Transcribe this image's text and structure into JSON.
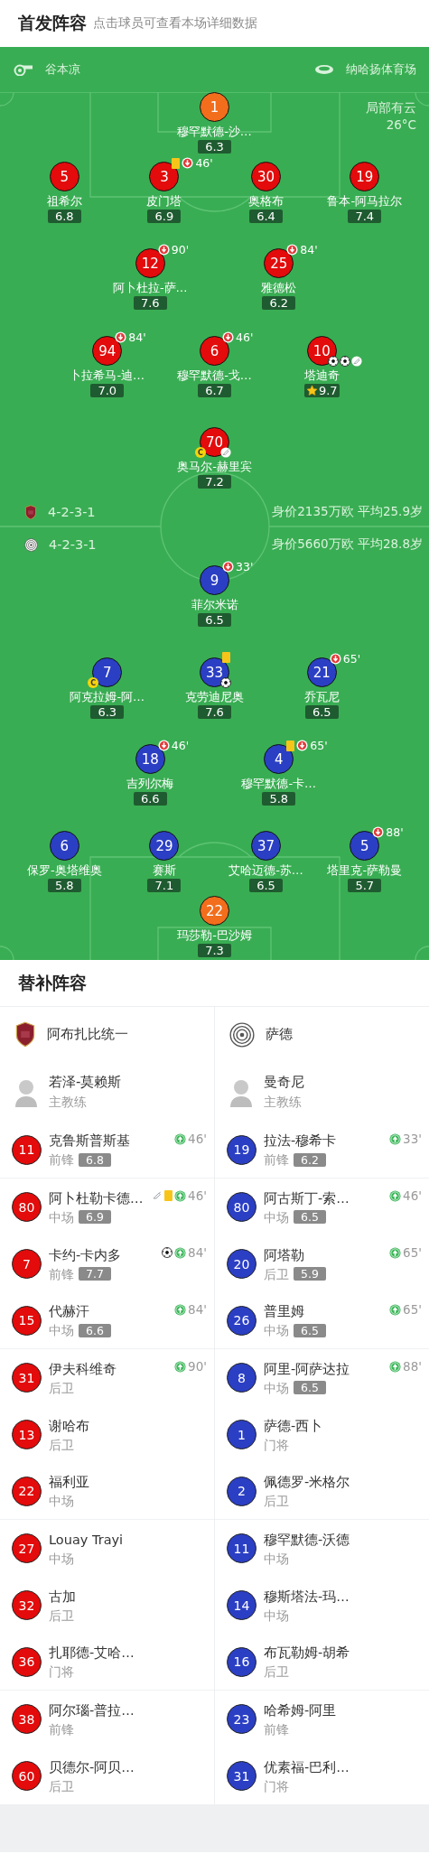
{
  "header": {
    "title": "首发阵容",
    "subtitle": "点击球员可查看本场详细数据"
  },
  "pitch": {
    "referee": "谷本凉",
    "stadium": "纳哈扬体育场",
    "weather": "局部有云",
    "temperature": "26°C",
    "home": {
      "formation": "4-2-3-1",
      "summary": "身价2135万欧 平均25.9岁",
      "lines": [
        {
          "players": [
            {
              "number": "1",
              "name": "穆罕默德-沙…",
              "rating": "6.3",
              "color": "#f26d1c",
              "mvp": false
            }
          ]
        },
        {
          "players": [
            {
              "number": "5",
              "name": "祖希尔",
              "rating": "6.8",
              "color": "#e30b0b",
              "mvp": false
            },
            {
              "number": "3",
              "name": "皮门塔",
              "rating": "6.9",
              "color": "#e30b0b",
              "mvp": false,
              "events": [
                {
                  "kind": "yellow_card"
                },
                {
                  "kind": "sub_off",
                  "minute": "46'"
                }
              ]
            },
            {
              "number": "30",
              "name": "奥格布",
              "rating": "6.4",
              "color": "#e30b0b",
              "mvp": false
            },
            {
              "number": "19",
              "name": "鲁本-阿马拉尔",
              "rating": "7.4",
              "color": "#e30b0b",
              "mvp": false
            }
          ]
        },
        {
          "players": [
            {
              "number": "12",
              "name": "阿卜杜拉-萨…",
              "rating": "7.6",
              "color": "#e30b0b",
              "mvp": false,
              "events": [
                {
                  "kind": "sub_off",
                  "minute": "90'"
                }
              ]
            },
            {
              "number": "25",
              "name": "雅德松",
              "rating": "6.2",
              "color": "#e30b0b",
              "mvp": false,
              "events": [
                {
                  "kind": "sub_off",
                  "minute": "84'"
                }
              ]
            }
          ]
        },
        {
          "players": [
            {
              "number": "94",
              "name": "卜拉希马-迪…",
              "rating": "7.0",
              "color": "#e30b0b",
              "mvp": false,
              "events": [
                {
                  "kind": "sub_off",
                  "minute": "84'"
                }
              ]
            },
            {
              "number": "6",
              "name": "穆罕默德-戈…",
              "rating": "6.7",
              "color": "#e30b0b",
              "mvp": false,
              "events": [
                {
                  "kind": "sub_off",
                  "minute": "46'"
                }
              ]
            },
            {
              "number": "10",
              "name": "塔迪奇",
              "rating": "9.7",
              "color": "#e30b0b",
              "mvp": true,
              "events": [
                {
                  "kind": "goal"
                },
                {
                  "kind": "goal"
                },
                {
                  "kind": "assist"
                }
              ]
            }
          ]
        },
        {
          "players": [
            {
              "number": "70",
              "name": "奥马尔-赫里宾",
              "rating": "7.2",
              "color": "#e30b0b",
              "mvp": false,
              "captain_badge": "C",
              "events": [
                {
                  "kind": "assist"
                }
              ]
            }
          ]
        }
      ]
    },
    "away": {
      "formation": "4-2-3-1",
      "summary": "身价5660万欧 平均28.8岁",
      "lines": [
        {
          "players": [
            {
              "number": "9",
              "name": "菲尔米诺",
              "rating": "6.5",
              "color": "#2b3fc4",
              "mvp": false,
              "events": [
                {
                  "kind": "sub_off",
                  "minute": "33'"
                }
              ]
            }
          ]
        },
        {
          "players": [
            {
              "number": "7",
              "name": "阿克拉姆-阿…",
              "rating": "6.3",
              "color": "#2b3fc4",
              "mvp": false,
              "captain_badge": "C"
            },
            {
              "number": "33",
              "name": "克劳迪尼奥",
              "rating": "7.6",
              "color": "#2b3fc4",
              "mvp": false,
              "events": [
                {
                  "kind": "yellow_card"
                },
                {
                  "kind": "goal"
                }
              ]
            },
            {
              "number": "21",
              "name": "乔瓦尼",
              "rating": "6.5",
              "color": "#2b3fc4",
              "mvp": false,
              "events": [
                {
                  "kind": "sub_off",
                  "minute": "65'"
                }
              ]
            }
          ]
        },
        {
          "players": [
            {
              "number": "18",
              "name": "吉列尔梅",
              "rating": "6.6",
              "color": "#2b3fc4",
              "mvp": false,
              "events": [
                {
                  "kind": "sub_off",
                  "minute": "46'"
                }
              ]
            },
            {
              "number": "4",
              "name": "穆罕默德-卡…",
              "rating": "5.8",
              "color": "#2b3fc4",
              "mvp": false,
              "events": [
                {
                  "kind": "yellow_card"
                },
                {
                  "kind": "sub_off",
                  "minute": "65'"
                }
              ]
            }
          ]
        },
        {
          "players": [
            {
              "number": "6",
              "name": "保罗-奥塔维奥",
              "rating": "5.8",
              "color": "#2b3fc4",
              "mvp": false
            },
            {
              "number": "29",
              "name": "赛斯",
              "rating": "7.1",
              "color": "#2b3fc4",
              "mvp": false
            },
            {
              "number": "37",
              "name": "艾哈迈德-苏…",
              "rating": "6.5",
              "color": "#2b3fc4",
              "mvp": false
            },
            {
              "number": "5",
              "name": "塔里克-萨勒曼",
              "rating": "5.7",
              "color": "#2b3fc4",
              "mvp": false,
              "events": [
                {
                  "kind": "sub_off",
                  "minute": "88'"
                }
              ]
            }
          ]
        },
        {
          "players": [
            {
              "number": "22",
              "name": "玛莎勒-巴沙姆",
              "rating": "7.3",
              "color": "#f26d1c",
              "mvp": false
            }
          ]
        }
      ]
    }
  },
  "subs": {
    "title": "替补阵容",
    "home": {
      "team": "阿布扎比统一",
      "coach": "若泽-莫赖斯",
      "coach_role": "主教练",
      "color": "#e30b0b",
      "players": [
        {
          "number": "11",
          "name": "克鲁斯普斯基",
          "position": "前锋",
          "rating": "6.8",
          "events": [
            {
              "kind": "sub_on",
              "minute": "46'"
            }
          ]
        },
        {
          "number": "80",
          "name": "阿卜杜勒卡德…",
          "position": "中场",
          "rating": "6.9",
          "events": [
            {
              "kind": "assist"
            },
            {
              "kind": "yellow_card"
            },
            {
              "kind": "sub_on",
              "minute": "46'"
            }
          ]
        },
        {
          "number": "7",
          "name": "卡约-卡内多",
          "position": "前锋",
          "rating": "7.7",
          "events": [
            {
              "kind": "goal"
            },
            {
              "kind": "sub_on",
              "minute": "84'"
            }
          ]
        },
        {
          "number": "15",
          "name": "代赫汗",
          "position": "中场",
          "rating": "6.6",
          "events": [
            {
              "kind": "sub_on",
              "minute": "84'"
            }
          ]
        },
        {
          "number": "31",
          "name": "伊夫科维奇",
          "position": "后卫",
          "events": [
            {
              "kind": "sub_on",
              "minute": "90'"
            }
          ]
        },
        {
          "number": "13",
          "name": "谢哈布",
          "position": "后卫"
        },
        {
          "number": "22",
          "name": "福利亚",
          "position": "中场"
        },
        {
          "number": "27",
          "name": "Louay Trayi",
          "position": "中场"
        },
        {
          "number": "32",
          "name": "古加",
          "position": "后卫"
        },
        {
          "number": "36",
          "name": "扎耶德-艾哈…",
          "position": "门将"
        },
        {
          "number": "38",
          "name": "阿尔瑙-普拉…",
          "position": "前锋"
        },
        {
          "number": "60",
          "name": "贝德尔-阿贝…",
          "position": "后卫"
        }
      ]
    },
    "away": {
      "team": "萨德",
      "coach": "曼奇尼",
      "coach_role": "主教练",
      "color": "#2b3fc4",
      "players": [
        {
          "number": "19",
          "name": "拉法-穆希卡",
          "position": "前锋",
          "rating": "6.2",
          "events": [
            {
              "kind": "sub_on",
              "minute": "33'"
            }
          ]
        },
        {
          "number": "80",
          "name": "阿古斯丁-索…",
          "position": "中场",
          "rating": "6.5",
          "events": [
            {
              "kind": "sub_on",
              "minute": "46'"
            }
          ]
        },
        {
          "number": "20",
          "name": "阿塔勒",
          "position": "后卫",
          "rating": "5.9",
          "events": [
            {
              "kind": "sub_on",
              "minute": "65'"
            }
          ]
        },
        {
          "number": "26",
          "name": "普里姆",
          "position": "中场",
          "rating": "6.5",
          "events": [
            {
              "kind": "sub_on",
              "minute": "65'"
            }
          ]
        },
        {
          "number": "8",
          "name": "阿里-阿萨达拉",
          "position": "中场",
          "rating": "6.5",
          "events": [
            {
              "kind": "sub_on",
              "minute": "88'"
            }
          ]
        },
        {
          "number": "1",
          "name": "萨德-西卜",
          "position": "门将"
        },
        {
          "number": "2",
          "name": "佩德罗-米格尔",
          "position": "后卫"
        },
        {
          "number": "11",
          "name": "穆罕默德-沃德",
          "position": "中场"
        },
        {
          "number": "14",
          "name": "穆斯塔法-玛…",
          "position": "中场"
        },
        {
          "number": "16",
          "name": "布瓦勒姆-胡希",
          "position": "后卫"
        },
        {
          "number": "23",
          "name": "哈希姆-阿里",
          "position": "前锋"
        },
        {
          "number": "31",
          "name": "优素福-巴利…",
          "position": "门将"
        }
      ]
    }
  }
}
